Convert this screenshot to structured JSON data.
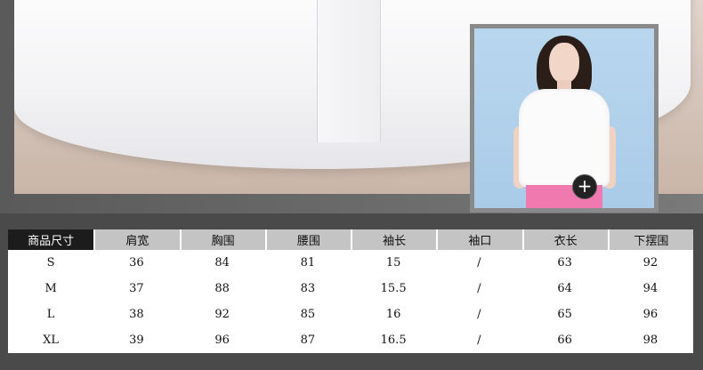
{
  "thumbnail": {
    "zoom_icon": "plus-icon",
    "zoom_symbol": "+"
  },
  "size_table": {
    "headers": [
      "商品尺寸",
      "肩宽",
      "胸围",
      "腰围",
      "袖长",
      "袖口",
      "衣长",
      "下摆围"
    ],
    "rows": [
      [
        "S",
        "36",
        "84",
        "81",
        "15",
        "/",
        "63",
        "92"
      ],
      [
        "M",
        "37",
        "88",
        "83",
        "15.5",
        "/",
        "64",
        "94"
      ],
      [
        "L",
        "38",
        "92",
        "85",
        "16",
        "/",
        "65",
        "96"
      ],
      [
        "XL",
        "39",
        "96",
        "87",
        "16.5",
        "/",
        "66",
        "98"
      ]
    ]
  },
  "colors": {
    "header_dark": "#1c1c1c",
    "header_gray": "#c4c4c4",
    "background": "#4a4a4a"
  }
}
